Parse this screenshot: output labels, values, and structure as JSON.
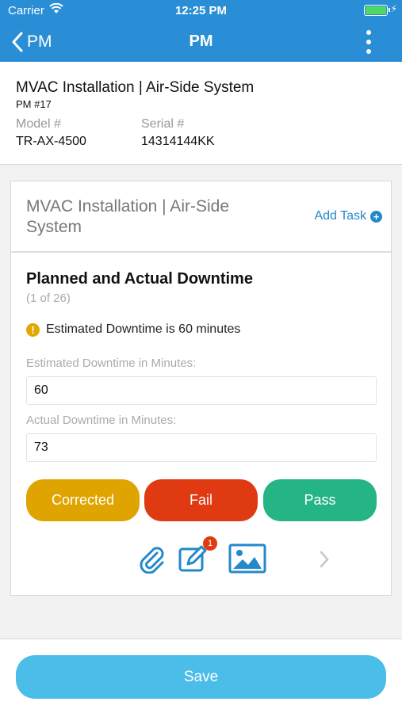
{
  "status_bar": {
    "carrier": "Carrier",
    "time": "12:25 PM",
    "battery_level": 1.0,
    "battery_color": "#4cd964"
  },
  "nav": {
    "back_label": "PM",
    "title": "PM",
    "icons": {
      "back": "chevron-left-icon",
      "more": "more-vertical-icon"
    }
  },
  "asset": {
    "title": "MVAC Installation | Air-Side System",
    "pm_number": "PM #17",
    "model_label": "Model #",
    "model_value": "TR-AX-4500",
    "serial_label": "Serial #",
    "serial_value": "14314144KK"
  },
  "checklist": {
    "title": "MVAC Installation | Air-Side System",
    "add_task_label": "Add Task",
    "task": {
      "title": "Planned and Actual Downtime",
      "count": "(1 of 26)",
      "warning": "Estimated Downtime is 60 minutes",
      "estimated_label": "Estimated Downtime in Minutes:",
      "estimated_value": "60",
      "actual_label": "Actual Downtime in Minutes:",
      "actual_value": "73"
    },
    "buttons": {
      "corrected": "Corrected",
      "fail": "Fail",
      "pass": "Pass"
    },
    "note_badge_count": "1",
    "icons": [
      "paperclip-icon",
      "edit-note-icon",
      "image-icon",
      "chevron-right-icon"
    ]
  },
  "colors": {
    "header": "#2a8ed6",
    "accent": "#2389c9",
    "corrected": "#e0a400",
    "fail": "#e03a12",
    "pass": "#25b485",
    "save": "#4bbde9"
  },
  "footer": {
    "save_label": "Save"
  }
}
